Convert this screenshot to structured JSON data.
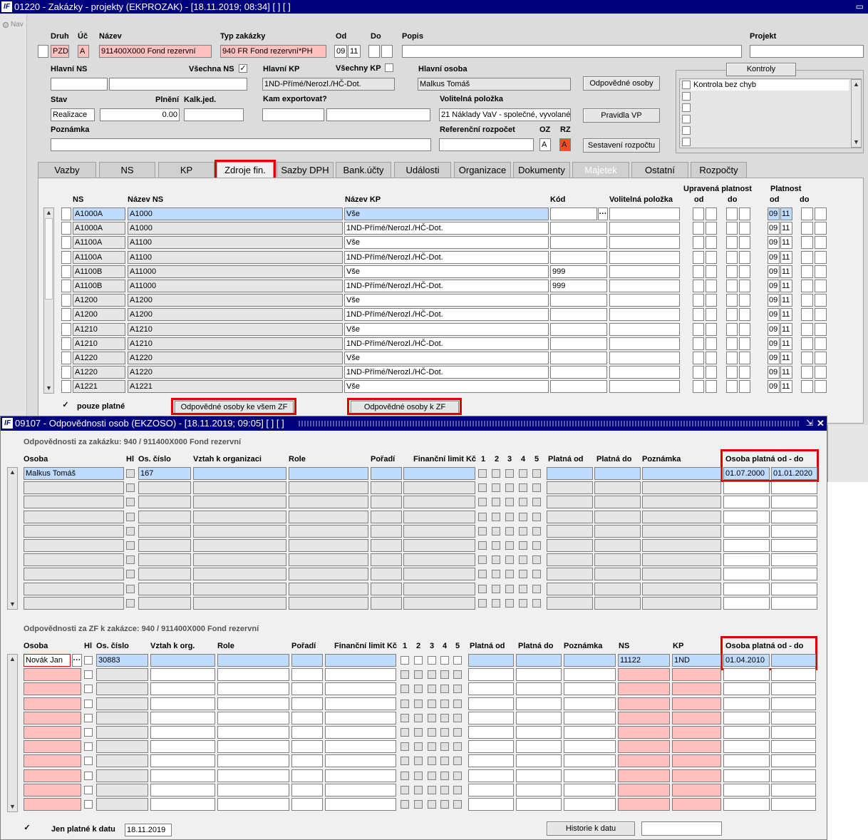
{
  "win1": {
    "title": "01220 - Zakázky - projekty (EKPROZAK) - [18.11.2019; 08:34]  [ ]  [ ]",
    "nav_label": "Nav",
    "labels": {
      "druh": "Druh",
      "uc": "Úč",
      "nazev": "Název",
      "typ": "Typ zakázky",
      "od": "Od",
      "do": "Do",
      "popis": "Popis",
      "projekt": "Projekt",
      "hlavni_ns": "Hlavní NS",
      "vsechna_ns": "Všechna NS",
      "hlavni_kp": "Hlavní KP",
      "vsechny_kp": "Všechny KP",
      "hlavni_osoba": "Hlavní osoba",
      "stav": "Stav",
      "plneni": "Plnění",
      "kalk": "Kalk.jed.",
      "kam_export": "Kam exportovat?",
      "volitelna": "Volitelná položka",
      "poznamka": "Poznámka",
      "ref_rozpocet": "Referenční rozpočet",
      "oz": "OZ",
      "rz": "RZ"
    },
    "values": {
      "druh": "PZD",
      "uc": "A",
      "nazev": "911400X000 Fond rezervní",
      "typ": "940 FR Fond rezervní*PH",
      "od1": "09",
      "od2": "11",
      "hlavni_kp": "1ND-Přímé/Nerozl./HČ-Dot.",
      "hlavni_osoba": "Malkus Tomáš",
      "stav": "Realizace",
      "plneni": "0.00",
      "volitelna": "21 Náklady VaV - společné, vyvolané",
      "oz": "A",
      "rz": "A"
    },
    "buttons": {
      "odpovedne_osoby": "Odpovědné osoby",
      "pravidla_vp": "Pravidla VP",
      "sestaveni": "Sestavení rozpočtu",
      "kontroly": "Kontroly"
    },
    "kontroly_item": "Kontrola bez chyb",
    "vsechna_ns_mark": "✓",
    "tabs": [
      "Vazby",
      "NS",
      "KP",
      "Zdroje fin.",
      "Sazby DPH",
      "Bank.účty",
      "Události",
      "Organizace",
      "Dokumenty",
      "Majetek",
      "Ostatní",
      "Rozpočty"
    ],
    "grid": {
      "headers": {
        "ns": "NS",
        "nazev_ns": "Název NS",
        "nazev_kp": "Název KP",
        "kod": "Kód",
        "volitelna": "Volitelná položka",
        "upravena": "Upravená platnost",
        "up_od": "od",
        "up_do": "do",
        "platnost": "Platnost",
        "pl_od": "od",
        "pl_do": "do"
      },
      "ellipsis": "···",
      "rows": [
        {
          "ns": "A1000A",
          "nazev_ns": "A1000",
          "nazev_kp": "Vše",
          "kod": "",
          "p1": "09",
          "p2": "11"
        },
        {
          "ns": "A1000A",
          "nazev_ns": "A1000",
          "nazev_kp": "1ND-Přímé/Nerozl./HČ-Dot.",
          "kod": "",
          "p1": "09",
          "p2": "11"
        },
        {
          "ns": "A1100A",
          "nazev_ns": "A1100",
          "nazev_kp": "Vše",
          "kod": "",
          "p1": "09",
          "p2": "11"
        },
        {
          "ns": "A1100A",
          "nazev_ns": "A1100",
          "nazev_kp": "1ND-Přímé/Nerozl./HČ-Dot.",
          "kod": "",
          "p1": "09",
          "p2": "11"
        },
        {
          "ns": "A1100B",
          "nazev_ns": "A11000",
          "nazev_kp": "Vše",
          "kod": "999",
          "p1": "09",
          "p2": "11"
        },
        {
          "ns": "A1100B",
          "nazev_ns": "A11000",
          "nazev_kp": "1ND-Přímé/Nerozl./HČ-Dot.",
          "kod": "999",
          "p1": "09",
          "p2": "11"
        },
        {
          "ns": "A1200",
          "nazev_ns": "A1200",
          "nazev_kp": "Vše",
          "kod": "",
          "p1": "09",
          "p2": "11"
        },
        {
          "ns": "A1200",
          "nazev_ns": "A1200",
          "nazev_kp": "1ND-Přímé/Nerozl./HČ-Dot.",
          "kod": "",
          "p1": "09",
          "p2": "11"
        },
        {
          "ns": "A1210",
          "nazev_ns": "A1210",
          "nazev_kp": "Vše",
          "kod": "",
          "p1": "09",
          "p2": "11"
        },
        {
          "ns": "A1210",
          "nazev_ns": "A1210",
          "nazev_kp": "1ND-Přímé/Nerozl./HČ-Dot.",
          "kod": "",
          "p1": "09",
          "p2": "11"
        },
        {
          "ns": "A1220",
          "nazev_ns": "A1220",
          "nazev_kp": "Vše",
          "kod": "",
          "p1": "09",
          "p2": "11"
        },
        {
          "ns": "A1220",
          "nazev_ns": "A1220",
          "nazev_kp": "1ND-Přímé/Nerozl./HČ-Dot.",
          "kod": "",
          "p1": "09",
          "p2": "11"
        },
        {
          "ns": "A1221",
          "nazev_ns": "A1221",
          "nazev_kp": "Vše",
          "kod": "",
          "p1": "09",
          "p2": "11"
        }
      ]
    },
    "pouze_platne": "pouze platné",
    "pouze_mark": "✓",
    "btn_vsem_zf": "Odpovědné osoby ke všem ZF",
    "btn_k_zf": "Odpovědné osoby k ZF"
  },
  "win2": {
    "title": "09107 - Odpovědnosti osob (EKZOSO) - [18.11.2019; 09:05]  [ ]  [ ]",
    "sec1_title": "Odpovědnosti za zakázku: 940 / 911400X000 Fond rezervní",
    "sec1_headers": {
      "osoba": "Osoba",
      "hl": "Hl",
      "os_cislo": "Os. číslo",
      "vztah": "Vztah k organizaci",
      "role": "Role",
      "poradi": "Pořadí",
      "limit": "Finanční limit Kč",
      "c1": "1",
      "c2": "2",
      "c3": "3",
      "c4": "4",
      "c5": "5",
      "platna_od": "Platná od",
      "platna_do": "Platná do",
      "poznamka": "Poznámka",
      "osoba_platna": "Osoba platná od - do"
    },
    "sec1_row": {
      "osoba": "Malkus Tomáš",
      "os_cislo": "167",
      "od": "01.07.2000",
      "do": "01.01.2020"
    },
    "sec2_title": "Odpovědnosti za ZF k zakázce: 940 / 911400X000 Fond rezervní",
    "sec2_headers": {
      "osoba": "Osoba",
      "hl": "Hl",
      "os_cislo": "Os. číslo",
      "vztah": "Vztah k org.",
      "role": "Role",
      "poradi": "Pořadí",
      "limit": "Finanční limit Kč",
      "c1": "1",
      "c2": "2",
      "c3": "3",
      "c4": "4",
      "c5": "5",
      "platna_od": "Platná od",
      "platna_do": "Platná do",
      "poznamka": "Poznámka",
      "ns": "NS",
      "kp": "KP",
      "osoba_platna": "Osoba platná od - do"
    },
    "sec2_row": {
      "osoba": "Novák Jan",
      "os_cislo": "30883",
      "ns": "11122",
      "kp": "1ND",
      "od": "01.04.2010"
    },
    "ellipsis": "···",
    "jen_platne": "Jen platné k datu",
    "jen_mark": "✓",
    "jen_date": "18.11.2019",
    "historie": "Historie k datu"
  }
}
